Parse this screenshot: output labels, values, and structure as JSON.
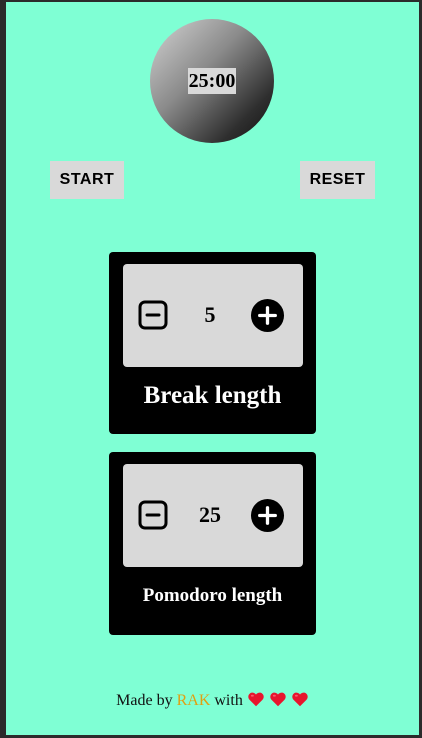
{
  "timer": {
    "display": "25:00"
  },
  "controls": {
    "start_label": "START",
    "reset_label": "RESET"
  },
  "break": {
    "value": "5",
    "label": "Break length",
    "decrement_icon": "minus-square-icon",
    "increment_icon": "plus-circle-icon"
  },
  "pomodoro": {
    "value": "25",
    "label": "Pomodoro length",
    "decrement_icon": "minus-square-icon",
    "increment_icon": "plus-circle-icon"
  },
  "footer": {
    "prefix": "Made by ",
    "author": "RAK",
    "suffix": " with",
    "hearts": [
      "heart-icon",
      "heart-icon",
      "heart-icon"
    ]
  },
  "colors": {
    "background": "#7fffd4",
    "card": "#000000",
    "panel": "#d9d9d9",
    "author": "#e0a012",
    "heart": "#e8152d"
  }
}
